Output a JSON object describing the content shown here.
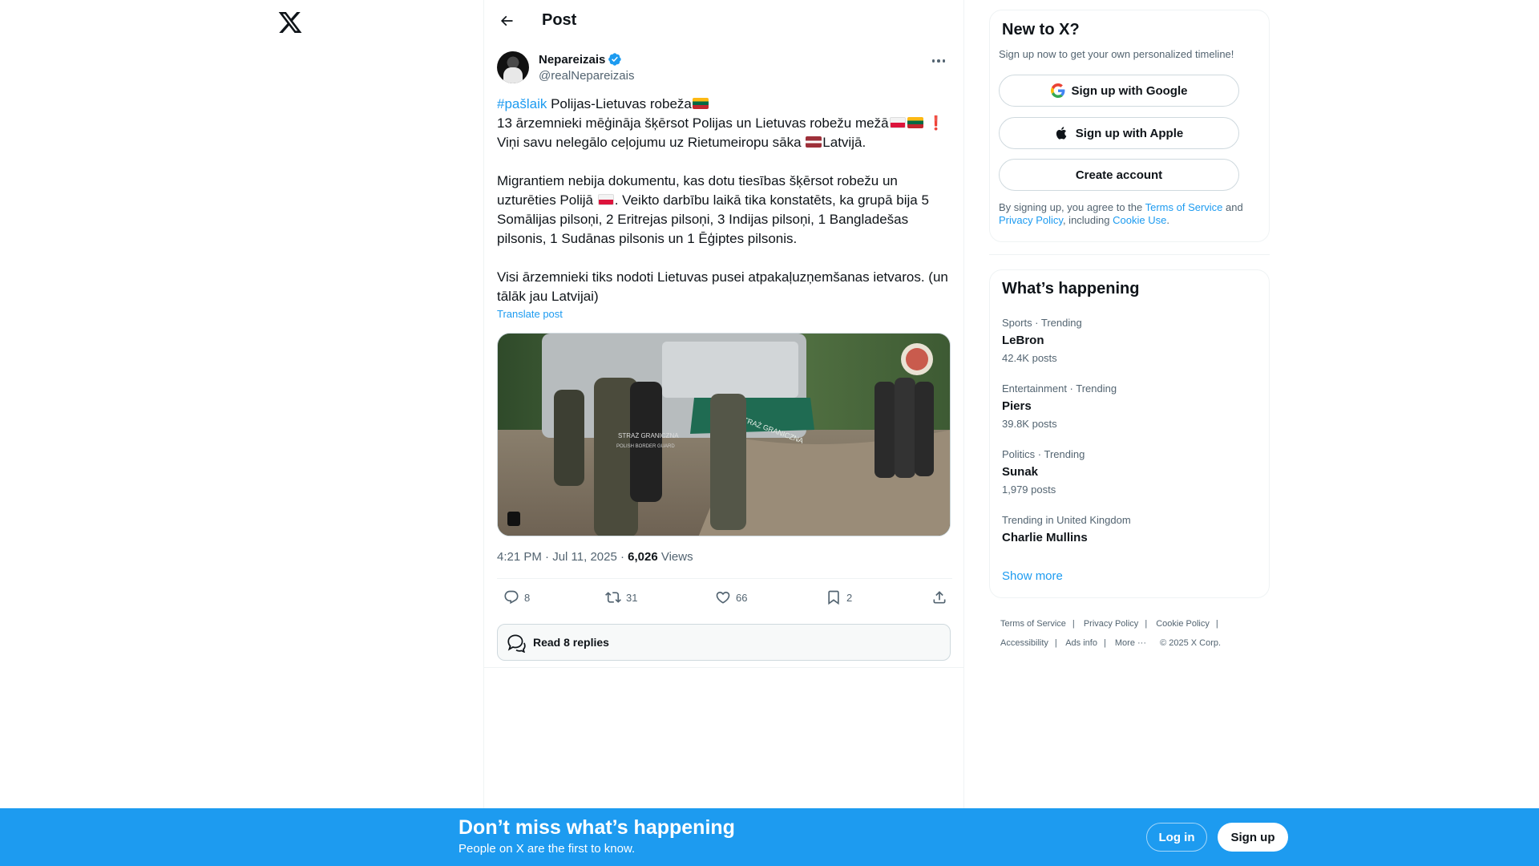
{
  "header": {
    "title": "Post"
  },
  "post": {
    "author_name": "Nepareizais",
    "author_handle": "@realNepareizais",
    "hashtag": "#pašlaik",
    "line1_rest": " Polijas-Lietuvas robeža",
    "line2": "13 ārzemnieki mēģināja šķērsot Polijas un Lietuvas robežu mežā",
    "line3_a": "Viņi savu nelegālo ceļojumu uz Rietumeiropu sāka ",
    "line3_b": "Latvijā.",
    "para2_a": "Migrantiem nebija dokumentu, kas dotu tiesības šķērsot robežu un uzturēties Polijā ",
    "para2_b": ". Veikto darbību laikā tika konstatēts, ka grupā bija 5 Somālijas pilsoņi, 2 Eritrejas pilsoņi, 3 Indijas pilsoņi, 1 Bangladešas pilsonis, 1 Sudānas pilsonis un 1 Ēģiptes pilsonis.",
    "para3": "Visi ārzemnieki tiks nodoti Lietuvas pusei atpakaļuzņemšanas ietvaros. (un tālāk jau Latvijai)",
    "translate_label": "Translate post",
    "timestamp": "4:21 PM · Jul 11, 2025 · ",
    "views_count": "6,026",
    "views_label": " Views",
    "media_vehicle_text": "STRAŻ GRANICZNA",
    "media_vest_text_1": "STRAŻ GRANICZNA",
    "media_vest_text_2": "POLISH BORDER GUARD"
  },
  "actions": {
    "replies": "8",
    "reposts": "31",
    "likes": "66",
    "bookmarks": "2"
  },
  "read_replies": "Read 8 replies",
  "signup_card": {
    "title": "New to X?",
    "subtitle": "Sign up now to get your own personalized timeline!",
    "google": "Sign up with Google",
    "apple": "Sign up with Apple",
    "create": "Create account",
    "legal_prefix": "By signing up, you agree to the ",
    "terms": "Terms of Service",
    "and": " and ",
    "privacy": "Privacy Policy",
    "including": ", including ",
    "cookie": "Cookie Use",
    "period": "."
  },
  "trending": {
    "title": "What’s happening",
    "items": [
      {
        "meta": "Sports · Trending",
        "name": "LeBron",
        "count": "42.4K posts"
      },
      {
        "meta": "Entertainment · Trending",
        "name": "Piers",
        "count": "39.8K posts"
      },
      {
        "meta": "Politics · Trending",
        "name": "Sunak",
        "count": "1,979 posts"
      },
      {
        "meta": "Trending in United Kingdom",
        "name": "Charlie Mullins",
        "count": ""
      }
    ],
    "show_more": "Show more"
  },
  "footer": {
    "terms": "Terms of Service",
    "privacy": "Privacy Policy",
    "cookie": "Cookie Policy",
    "accessibility": "Accessibility",
    "ads": "Ads info",
    "more": "More ···",
    "copyright": "© 2025 X Corp."
  },
  "banner": {
    "title": "Don’t miss what’s happening",
    "subtitle": "People on X are the first to know.",
    "login": "Log in",
    "signup": "Sign up"
  },
  "colors": {
    "accent": "#1d9bf0",
    "text": "#0f1419",
    "muted": "#536471",
    "border": "#eff3f4"
  }
}
